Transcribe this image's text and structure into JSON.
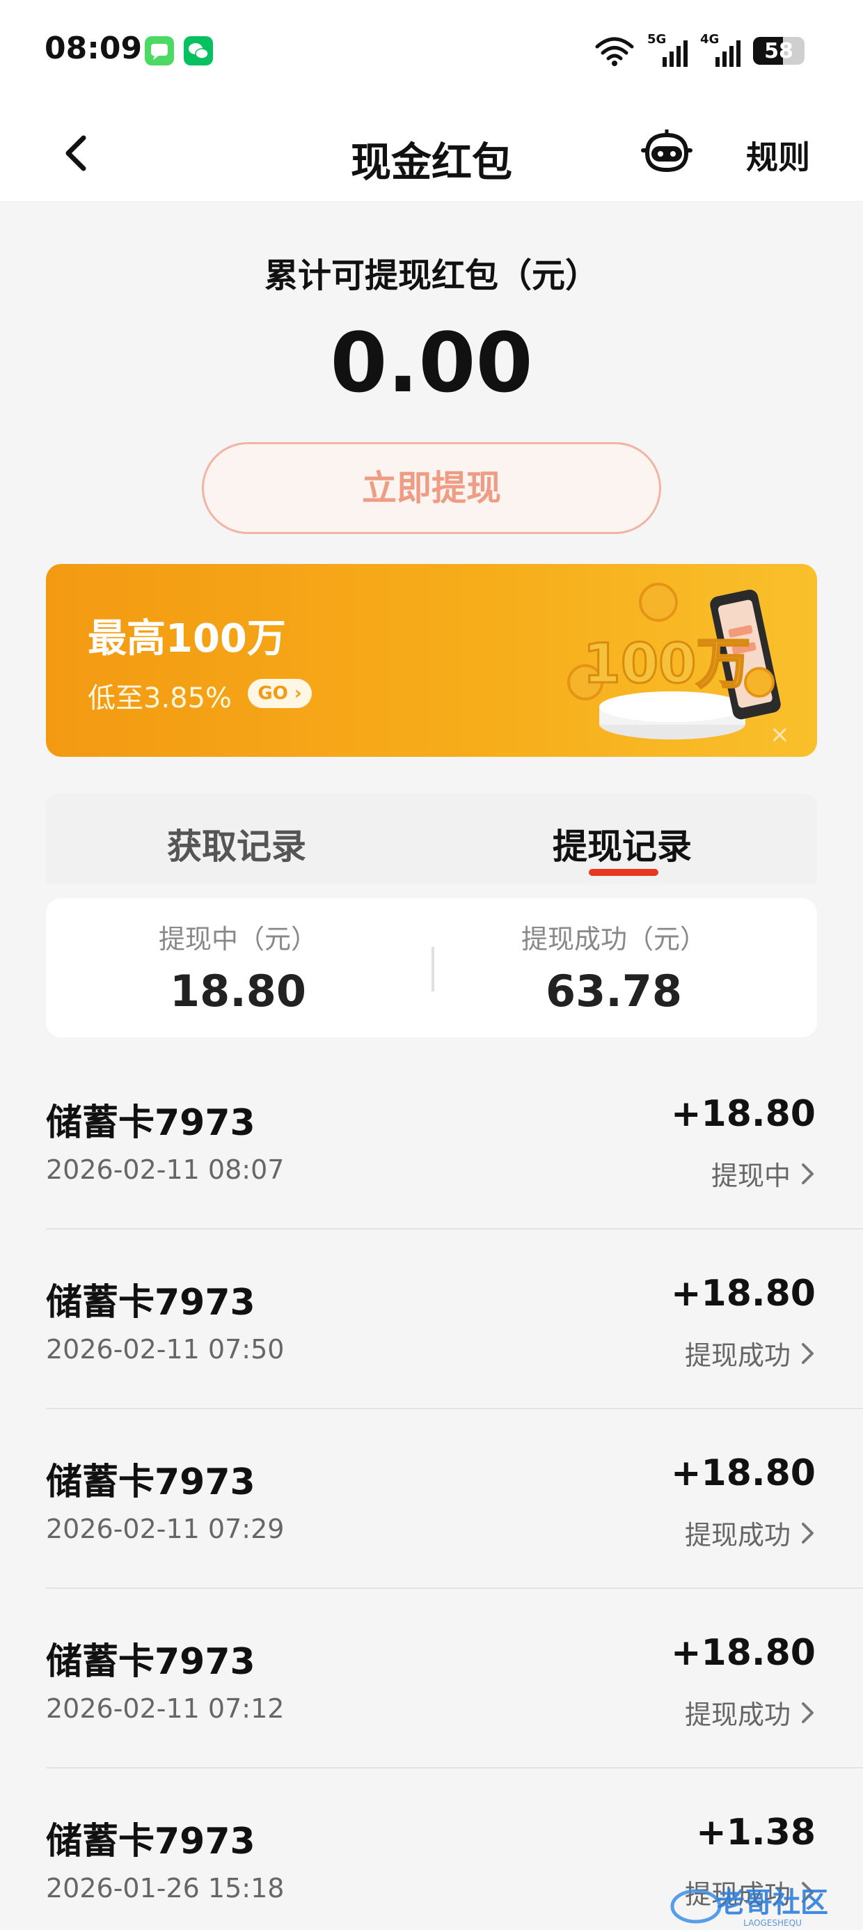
{
  "status_bar": {
    "time": "08:09",
    "signal1_label": "5G",
    "signal2_label": "4G",
    "battery_level": "58",
    "battery_fraction": 0.58
  },
  "header": {
    "title": "现金红包",
    "rules_label": "规则"
  },
  "balance": {
    "label": "累计可提现红包（元）",
    "value": "0.00",
    "withdraw_button": "立即提现"
  },
  "banner": {
    "title": "最高100万",
    "subtitle": "低至3.85%",
    "go_label": "GO",
    "art_text": "100万",
    "close_label": "×"
  },
  "tabs": [
    {
      "label": "获取记录",
      "active": false
    },
    {
      "label": "提现记录",
      "active": true
    }
  ],
  "summary": {
    "pending_label": "提现中（元）",
    "pending_value": "18.80",
    "success_label": "提现成功（元）",
    "success_value": "63.78"
  },
  "records": [
    {
      "name": "储蓄卡7973",
      "date": "2026-02-11 08:07",
      "amount": "+18.80",
      "status": "提现中"
    },
    {
      "name": "储蓄卡7973",
      "date": "2026-02-11 07:50",
      "amount": "+18.80",
      "status": "提现成功"
    },
    {
      "name": "储蓄卡7973",
      "date": "2026-02-11 07:29",
      "amount": "+18.80",
      "status": "提现成功"
    },
    {
      "name": "储蓄卡7973",
      "date": "2026-02-11 07:12",
      "amount": "+18.80",
      "status": "提现成功"
    },
    {
      "name": "储蓄卡7973",
      "date": "2026-01-26 15:18",
      "amount": "+1.38",
      "status": "提现成功"
    }
  ],
  "watermark": {
    "text": "老哥社区",
    "subtext": "LAOGESHEQU"
  },
  "colors": {
    "accent_red": "#e8361f",
    "banner_orange": "#f39a12",
    "button_border": "#f2b3a3",
    "button_text": "#ef9c84"
  }
}
